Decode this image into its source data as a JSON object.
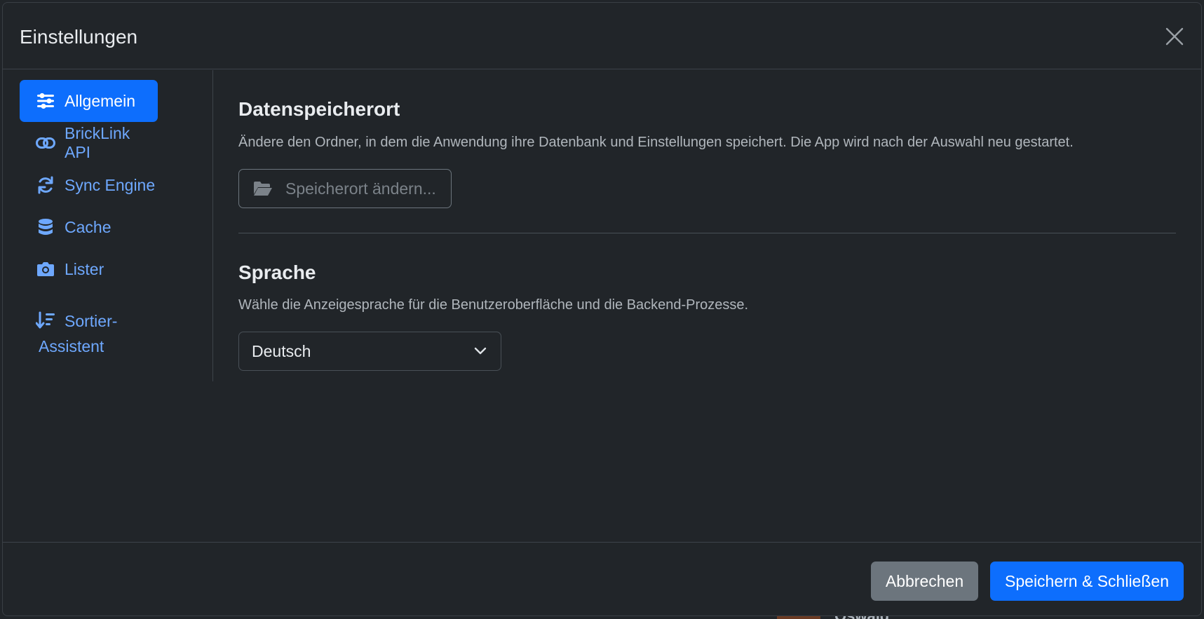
{
  "modal": {
    "title": "Einstellungen"
  },
  "sidebar": {
    "items": [
      {
        "label": "Allgemein",
        "icon": "sliders-icon",
        "active": true
      },
      {
        "label": "BrickLink API",
        "icon": "link-icon",
        "active": false
      },
      {
        "label": "Sync Engine",
        "icon": "sync-icon",
        "active": false
      },
      {
        "label": "Cache",
        "icon": "database-icon",
        "active": false
      },
      {
        "label": "Lister",
        "icon": "camera-icon",
        "active": false
      },
      {
        "label_line1": "Sortier-",
        "label_line2": "Assistent",
        "icon": "sort-icon",
        "active": false
      }
    ]
  },
  "storage": {
    "title": "Datenspeicherort",
    "description": "Ändere den Ordner, in dem die Anwendung ihre Datenbank und Einstellungen speichert. Die App wird nach der Auswahl neu gestartet.",
    "button_label": "Speicherort ändern..."
  },
  "language": {
    "title": "Sprache",
    "description": "Wähle die Anzeigesprache für die Benutzeroberfläche und die Backend-Prozesse.",
    "selected": "Deutsch"
  },
  "footer": {
    "cancel_label": "Abbrechen",
    "save_label": "Speichern & Schließen"
  },
  "background": {
    "peek_name": "Oswald"
  },
  "colors": {
    "accent": "#0d6efd",
    "link": "#6ea8fe",
    "secondary": "#6c757d",
    "surface": "#212529"
  }
}
